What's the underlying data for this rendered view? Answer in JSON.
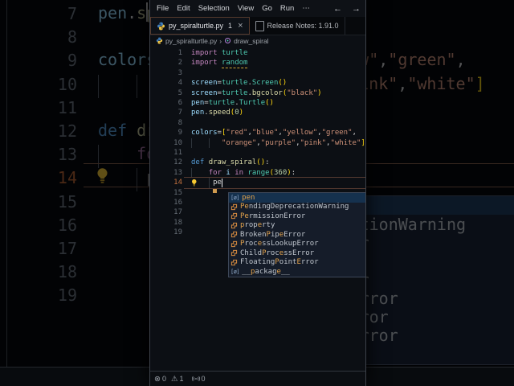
{
  "window": {
    "menu": {
      "items": [
        "File",
        "Edit",
        "Selection",
        "View",
        "Go",
        "Run",
        "⋯"
      ],
      "back_icon": "←",
      "forward_icon": "→"
    },
    "tabs": [
      {
        "title": "py_spiralturtle.py",
        "badge": "1",
        "close_label": "×",
        "active": true
      },
      {
        "title": "Release Notes: 1.91.0",
        "active": false
      }
    ],
    "breadcrumb": {
      "file": "py_spiralturtle.py",
      "separator": "›",
      "symbol": "draw_spiral"
    },
    "editor": {
      "code_lines": [
        {
          "n": 1,
          "s": [
            [
              "import",
              "kw"
            ],
            [
              " ",
              "txt"
            ],
            [
              "turtle",
              "type"
            ]
          ]
        },
        {
          "n": 2,
          "s": [
            [
              "import",
              "kw"
            ],
            [
              " ",
              "txt"
            ],
            [
              "random",
              "type sq"
            ]
          ]
        },
        {
          "n": 3,
          "s": []
        },
        {
          "n": 4,
          "s": [
            [
              "screen",
              "var"
            ],
            [
              "=",
              "txt"
            ],
            [
              "turtle",
              "type"
            ],
            [
              ".",
              "txt"
            ],
            [
              "Screen",
              "type"
            ],
            [
              "()",
              "brk"
            ]
          ]
        },
        {
          "n": 5,
          "s": [
            [
              "screen",
              "var"
            ],
            [
              "=",
              "txt"
            ],
            [
              "turtle",
              "type"
            ],
            [
              ".",
              "txt"
            ],
            [
              "bgcolor",
              "fn"
            ],
            [
              "(",
              "brk"
            ],
            [
              "\"black\"",
              "str"
            ],
            [
              ")",
              "brk"
            ]
          ]
        },
        {
          "n": 6,
          "s": [
            [
              "pen",
              "var"
            ],
            [
              "=",
              "txt"
            ],
            [
              "turtle",
              "type"
            ],
            [
              ".",
              "txt"
            ],
            [
              "Turtle",
              "type"
            ],
            [
              "()",
              "brk"
            ]
          ]
        },
        {
          "n": 7,
          "s": [
            [
              "pen",
              "var"
            ],
            [
              ".",
              "txt"
            ],
            [
              "speed",
              "fn"
            ],
            [
              "(",
              "brk"
            ],
            [
              "0",
              "num"
            ],
            [
              ")",
              "brk"
            ]
          ]
        },
        {
          "n": 8,
          "s": []
        },
        {
          "n": 9,
          "s": [
            [
              "colors",
              "var"
            ],
            [
              "=",
              "txt"
            ],
            [
              "[",
              "brk"
            ],
            [
              "\"red\"",
              "str"
            ],
            [
              ",",
              "txt"
            ],
            [
              "\"blue\"",
              "str"
            ],
            [
              ",",
              "txt"
            ],
            [
              "\"yellow\"",
              "str"
            ],
            [
              ",",
              "txt"
            ],
            [
              "\"green\"",
              "str"
            ],
            [
              ",",
              "txt"
            ]
          ]
        },
        {
          "n": 10,
          "s": [
            [
              "       ",
              "txt"
            ],
            [
              "\"orange\"",
              "str"
            ],
            [
              ",",
              "txt"
            ],
            [
              "\"purple\"",
              "str"
            ],
            [
              ",",
              "txt"
            ],
            [
              "\"pink\"",
              "str"
            ],
            [
              ",",
              "txt"
            ],
            [
              "\"white\"",
              "str"
            ],
            [
              "]",
              "brk"
            ]
          ],
          "guides": [
            0,
            4
          ]
        },
        {
          "n": 11,
          "s": []
        },
        {
          "n": 12,
          "s": [
            [
              "def",
              "def"
            ],
            [
              " ",
              "txt"
            ],
            [
              "draw_spiral",
              "fn"
            ],
            [
              "()",
              "brk"
            ],
            [
              ":",
              "txt"
            ]
          ]
        },
        {
          "n": 13,
          "s": [
            [
              "    ",
              "txt"
            ],
            [
              "for",
              "kw"
            ],
            [
              " ",
              "txt"
            ],
            [
              "i",
              "var"
            ],
            [
              " ",
              "txt"
            ],
            [
              "in",
              "kw"
            ],
            [
              " ",
              "txt"
            ],
            [
              "range",
              "type"
            ],
            [
              "(",
              "brk"
            ],
            [
              "360",
              "num"
            ],
            [
              ")",
              "brk"
            ],
            [
              ":",
              "txt"
            ]
          ],
          "guides": [
            0
          ]
        },
        {
          "n": 14,
          "s": [
            [
              "     ",
              "txt"
            ],
            [
              "pe",
              "txt"
            ]
          ],
          "guides": [
            4
          ],
          "current": true,
          "bulb": true
        },
        {
          "n": 15,
          "s": []
        },
        {
          "n": 16,
          "s": []
        },
        {
          "n": 17,
          "s": []
        },
        {
          "n": 18,
          "s": []
        },
        {
          "n": 19,
          "s": []
        }
      ]
    },
    "suggest": {
      "variable_icon_glyph": "[ø]",
      "rows": [
        {
          "icon": "variable",
          "selected": true,
          "segs": [
            [
              "pen",
              true
            ]
          ]
        },
        {
          "icon": "class",
          "segs": [
            [
              "Pe",
              true
            ],
            [
              "ndingDeprecationWarning",
              false
            ]
          ]
        },
        {
          "icon": "class",
          "segs": [
            [
              "Pe",
              true
            ],
            [
              "rmissionError",
              false
            ]
          ]
        },
        {
          "icon": "class",
          "segs": [
            [
              "p",
              true
            ],
            [
              "rop",
              false
            ],
            [
              "e",
              true
            ],
            [
              "rty",
              false
            ]
          ]
        },
        {
          "icon": "class",
          "segs": [
            [
              "Broken",
              false
            ],
            [
              "P",
              true
            ],
            [
              "ip",
              false
            ],
            [
              "e",
              true
            ],
            [
              "Error",
              false
            ]
          ]
        },
        {
          "icon": "class",
          "segs": [
            [
              "P",
              true
            ],
            [
              "roc",
              false
            ],
            [
              "e",
              true
            ],
            [
              "ssLookupError",
              false
            ]
          ]
        },
        {
          "icon": "class",
          "segs": [
            [
              "Child",
              false
            ],
            [
              "P",
              true
            ],
            [
              "roc",
              false
            ],
            [
              "e",
              true
            ],
            [
              "ssError",
              false
            ]
          ]
        },
        {
          "icon": "class",
          "segs": [
            [
              "Floating",
              false
            ],
            [
              "P",
              true
            ],
            [
              "oint",
              false
            ],
            [
              "E",
              true
            ],
            [
              "rror",
              false
            ]
          ]
        },
        {
          "icon": "variable",
          "segs": [
            [
              "__",
              false
            ],
            [
              "p",
              true
            ],
            [
              "ackag",
              false
            ],
            [
              "e",
              true
            ],
            [
              "__",
              false
            ]
          ]
        }
      ]
    },
    "status": {
      "error_count": "0",
      "warning_count": "1",
      "broadcast_count": "0"
    }
  },
  "colors": {
    "editor_bg": "#0c0f14",
    "keyword": "#c586c0",
    "def_keyword": "#569cd6",
    "type": "#4ec9b0",
    "variable": "#9cdcfe",
    "function": "#dcdcaa",
    "string": "#ce9178",
    "number": "#b5cea8",
    "bracket": "#ffd710",
    "match_highlight": "#e2a24c",
    "class_icon": "#d78b40",
    "current_line_number": "#c1703e",
    "suggest_bg": "#151c29",
    "suggest_selected_bg": "#15314e",
    "lightbulb": "#f8ca32"
  }
}
